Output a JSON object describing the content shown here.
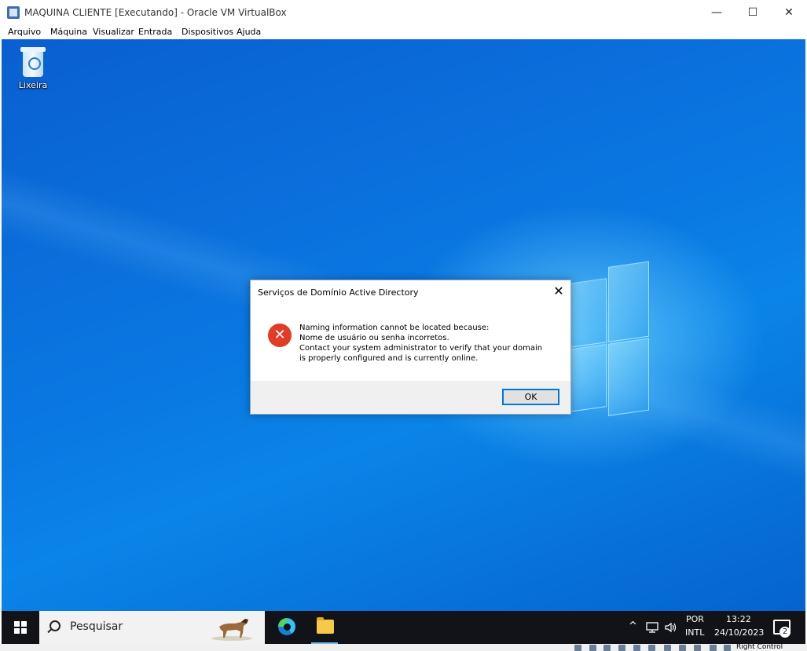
{
  "window": {
    "title": "MAQUINA CLIENTE [Executando] - Oracle VM VirtualBox",
    "controls": {
      "minimize": "—",
      "maximize": "☐",
      "close": "✕"
    }
  },
  "menu": [
    "Arquivo",
    "Máquina",
    "Visualizar",
    "Entrada",
    "Dispositivos",
    "Ajuda"
  ],
  "desktop": {
    "recycle_bin_label": "Lixeira"
  },
  "dialog": {
    "title": "Serviços de Domínio Active Directory",
    "close": "✕",
    "icon": "error-icon",
    "message_lines": [
      "Naming information cannot be located because:",
      "Nome de usuário ou senha incorretos.",
      "Contact your system administrator to verify that your domain",
      "is properly configured and is currently online."
    ],
    "ok_label": "OK"
  },
  "taskbar": {
    "search_placeholder": "Pesquisar",
    "pinned": [
      "edge-icon",
      "file-explorer-icon"
    ],
    "tray": {
      "chevron": "^",
      "language_top": "POR",
      "language_bottom": "INTL",
      "time": "13:22",
      "date": "24/10/2023",
      "notification_count": "2"
    }
  },
  "statusbar": {
    "host_key": "Right Control"
  },
  "colors": {
    "desktop_blue": "#0a78e2",
    "error_red": "#e23b27",
    "accent": "#0078d7",
    "taskbar": "#111318"
  }
}
